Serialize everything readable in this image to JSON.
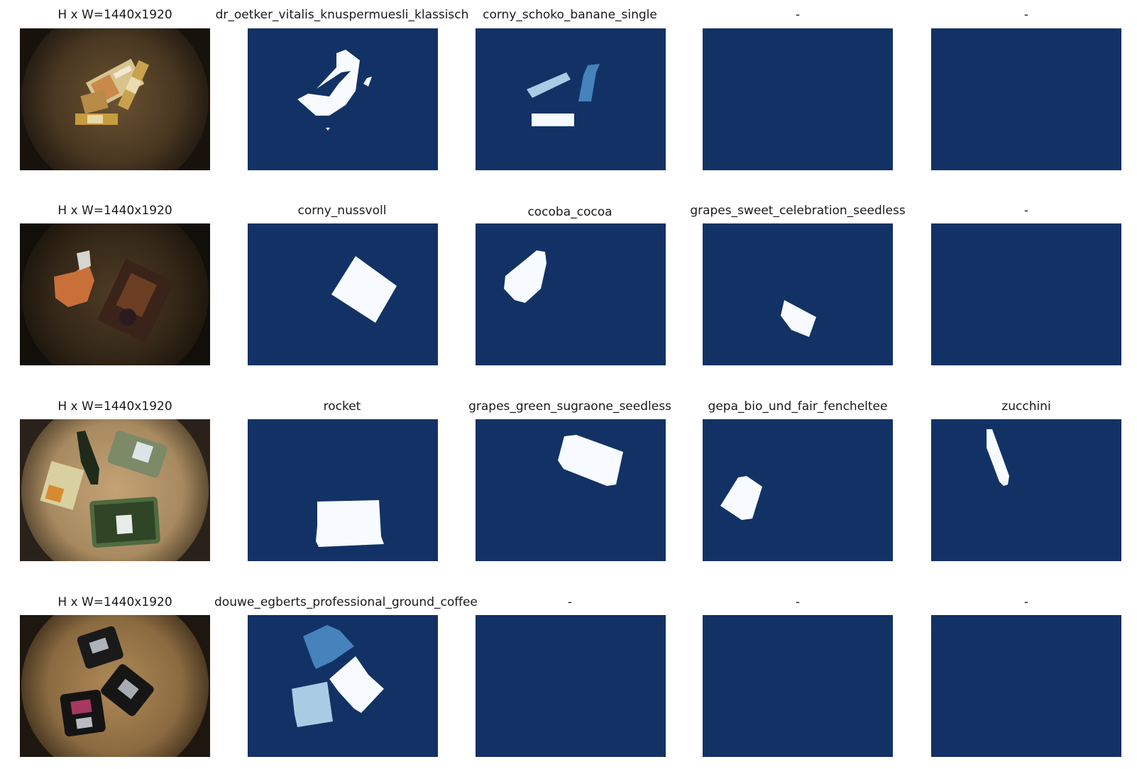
{
  "colors": {
    "mask_bg": "#123266",
    "mask_white": "#f7fbff",
    "mask_mid": "#4682bb",
    "mask_light": "#a9cbe4"
  },
  "rows": [
    {
      "image_label": "H x W=1440x1920",
      "scene": "snack-bars",
      "masks": [
        {
          "label": "dr_oetker_vitalis_knuspermuesli_klassisch",
          "content": "muesli-bar-shape"
        },
        {
          "label": "corny_schoko_banane_single",
          "content": "three-bars"
        },
        {
          "label": "-",
          "content": "empty"
        },
        {
          "label": "-",
          "content": "empty"
        }
      ]
    },
    {
      "image_label": "H x W=1440x1920",
      "scene": "nut-bar-cocoa-grapes",
      "masks": [
        {
          "label": "corny_nussvoll",
          "content": "square-pack"
        },
        {
          "label": "cocoba_cocoa",
          "content": "bottle-shape"
        },
        {
          "label": "grapes_sweet_celebration_seedless",
          "content": "small-box"
        },
        {
          "label": "-",
          "content": "empty"
        }
      ]
    },
    {
      "image_label": "H x W=1440x1920",
      "scene": "vegetables",
      "masks": [
        {
          "label": "rocket",
          "content": "rocket-tray"
        },
        {
          "label": "grapes_green_sugraone_seedless",
          "content": "grapes-tray"
        },
        {
          "label": "gepa_bio_und_fair_fencheltee",
          "content": "tea-box"
        },
        {
          "label": "zucchini",
          "content": "zucchini"
        }
      ]
    },
    {
      "image_label": "H x W=1440x1920",
      "scene": "coffee-packs",
      "masks": [
        {
          "label": "douwe_egberts_professional_ground_coffee",
          "content": "three-coffee-packs"
        },
        {
          "label": "-",
          "content": "empty"
        },
        {
          "label": "-",
          "content": "empty"
        },
        {
          "label": "-",
          "content": "empty"
        }
      ]
    }
  ]
}
